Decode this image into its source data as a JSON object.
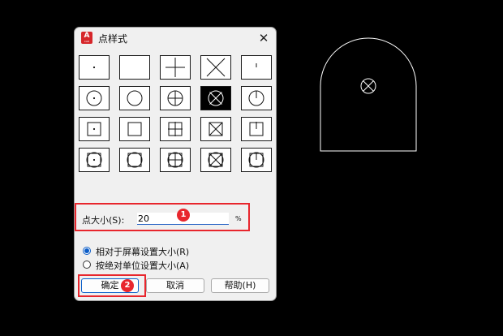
{
  "dialog": {
    "title": "点样式",
    "app_icon_letter": "A",
    "app_icon_sub": "CAD",
    "close_symbol": "✕",
    "point_styles": [
      {
        "id": "dot",
        "selected": false
      },
      {
        "id": "none",
        "selected": false
      },
      {
        "id": "plus",
        "selected": false
      },
      {
        "id": "x",
        "selected": false
      },
      {
        "id": "tick",
        "selected": false
      },
      {
        "id": "circle-dot",
        "selected": false
      },
      {
        "id": "circle",
        "selected": false
      },
      {
        "id": "circle-plus",
        "selected": false
      },
      {
        "id": "circle-x",
        "selected": true
      },
      {
        "id": "circle-tick",
        "selected": false
      },
      {
        "id": "square-dot",
        "selected": false
      },
      {
        "id": "square",
        "selected": false
      },
      {
        "id": "square-plus",
        "selected": false
      },
      {
        "id": "square-x",
        "selected": false
      },
      {
        "id": "square-tick",
        "selected": false
      },
      {
        "id": "circle-square-dot",
        "selected": false
      },
      {
        "id": "circle-square",
        "selected": false
      },
      {
        "id": "circle-square-plus",
        "selected": false
      },
      {
        "id": "circle-square-x",
        "selected": false
      },
      {
        "id": "circle-square-tick",
        "selected": false
      }
    ],
    "point_size": {
      "label": "点大小(S):",
      "value": "20",
      "unit": "%"
    },
    "size_mode": {
      "options": [
        {
          "label": "相对于屏幕设置大小(R)",
          "checked": true
        },
        {
          "label": "按绝对单位设置大小(A)",
          "checked": false
        }
      ]
    },
    "buttons": {
      "ok": "确定",
      "cancel": "取消",
      "help": "帮助(H)"
    }
  },
  "annotations": {
    "badge_1": "1",
    "badge_2": "2"
  },
  "colors": {
    "canvas_bg": "#000000",
    "cad_stroke": "#ffffff",
    "highlight": "#e8262d",
    "accent": "#0b5cc7"
  }
}
